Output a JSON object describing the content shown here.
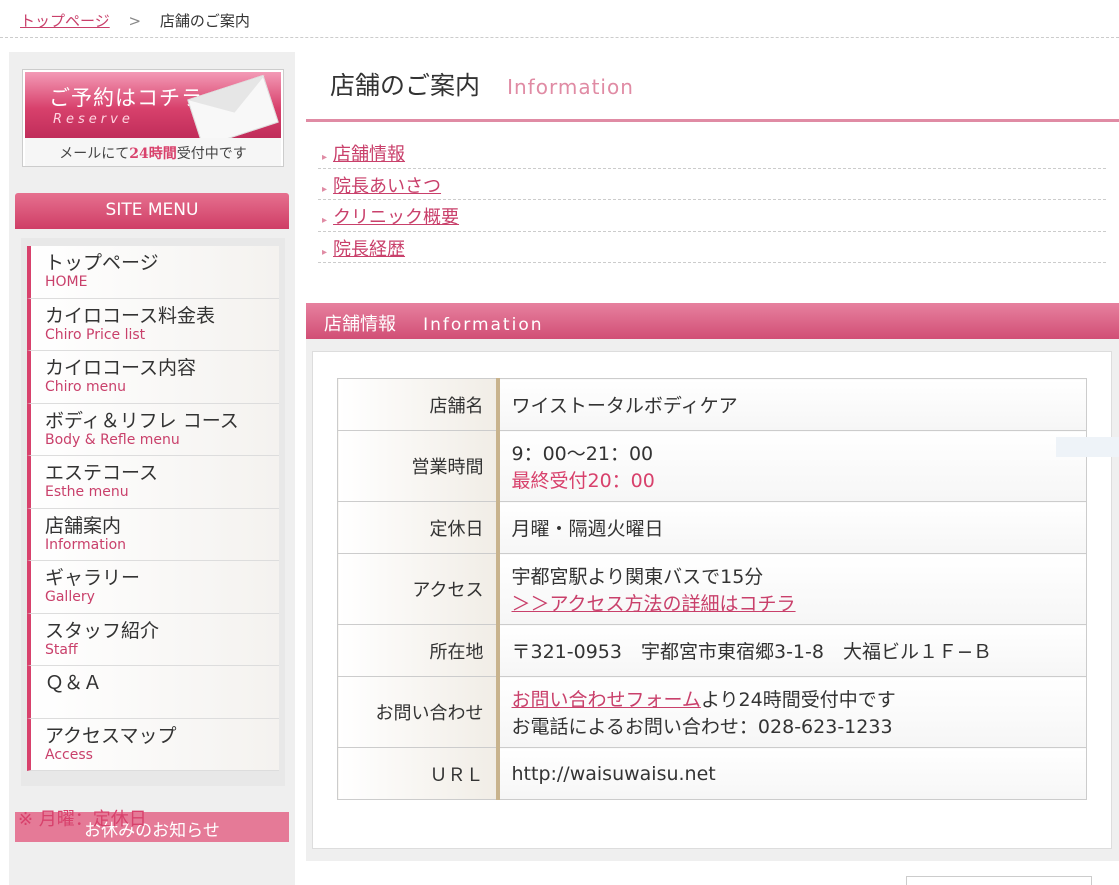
{
  "breadcrumb": {
    "home": "トップページ",
    "sep": ">",
    "current": "店舗のご案内"
  },
  "reserve": {
    "title": "ご予約はコチラ",
    "sub": "Reserve",
    "note_pre": "メールにて",
    "note_hl": "24時間",
    "note_post": "受付中です"
  },
  "site_menu": {
    "title": "SITE MENU",
    "items": [
      {
        "jp": "トップページ",
        "en": "HOME"
      },
      {
        "jp": "カイロコース料金表",
        "en": "Chiro Price list"
      },
      {
        "jp": "カイロコース内容",
        "en": "Chiro menu"
      },
      {
        "jp": "ボディ＆リフレ コース",
        "en": "Body & Refle menu"
      },
      {
        "jp": "エステコース",
        "en": "Esthe menu"
      },
      {
        "jp": "店舗案内",
        "en": "Information"
      },
      {
        "jp": "ギャラリー",
        "en": "Gallery"
      },
      {
        "jp": "スタッフ紹介",
        "en": "Staff"
      },
      {
        "jp": "Ｑ＆Ａ",
        "en": ""
      },
      {
        "jp": "アクセスマップ",
        "en": "Access"
      }
    ]
  },
  "holiday": {
    "title": "お休みのお知らせ",
    "line": "※ 月曜：定休日"
  },
  "page": {
    "title": "店舗のご案内",
    "title_en": "Information"
  },
  "links": [
    "店舗情報",
    "院長あいさつ",
    "クリニック概要",
    "院長経歴"
  ],
  "section": {
    "title": "店舗情報",
    "title_en": "Information"
  },
  "info": {
    "name_k": "店舗名",
    "name_v": "ワイストータルボディケア",
    "hours_k": "営業時間",
    "hours_v1": "9：00～21：00",
    "hours_v2": "最終受付20：00",
    "closed_k": "定休日",
    "closed_v": "月曜・隔週火曜日",
    "access_k": "アクセス",
    "access_v1": "宇都宮駅より関東バスで15分",
    "access_v2": "＞＞アクセス方法の詳細はコチラ",
    "addr_k": "所在地",
    "addr_v": "〒321-0953　宇都宮市東宿郷3-1-8　大福ビル１Ｆ−Ｂ",
    "contact_k": "お問い合わせ",
    "contact_link": "お問い合わせフォーム",
    "contact_v1": "より24時間受付中です",
    "contact_v2": "お電話によるお問い合わせ：028-623-1233",
    "url_k": "ＵＲＬ",
    "url_v": "http://waisuwaisu.net"
  },
  "colors": {
    "accent": "#d8416c",
    "accent_light": "#e08ba4",
    "key_border": "#c8b38d"
  }
}
